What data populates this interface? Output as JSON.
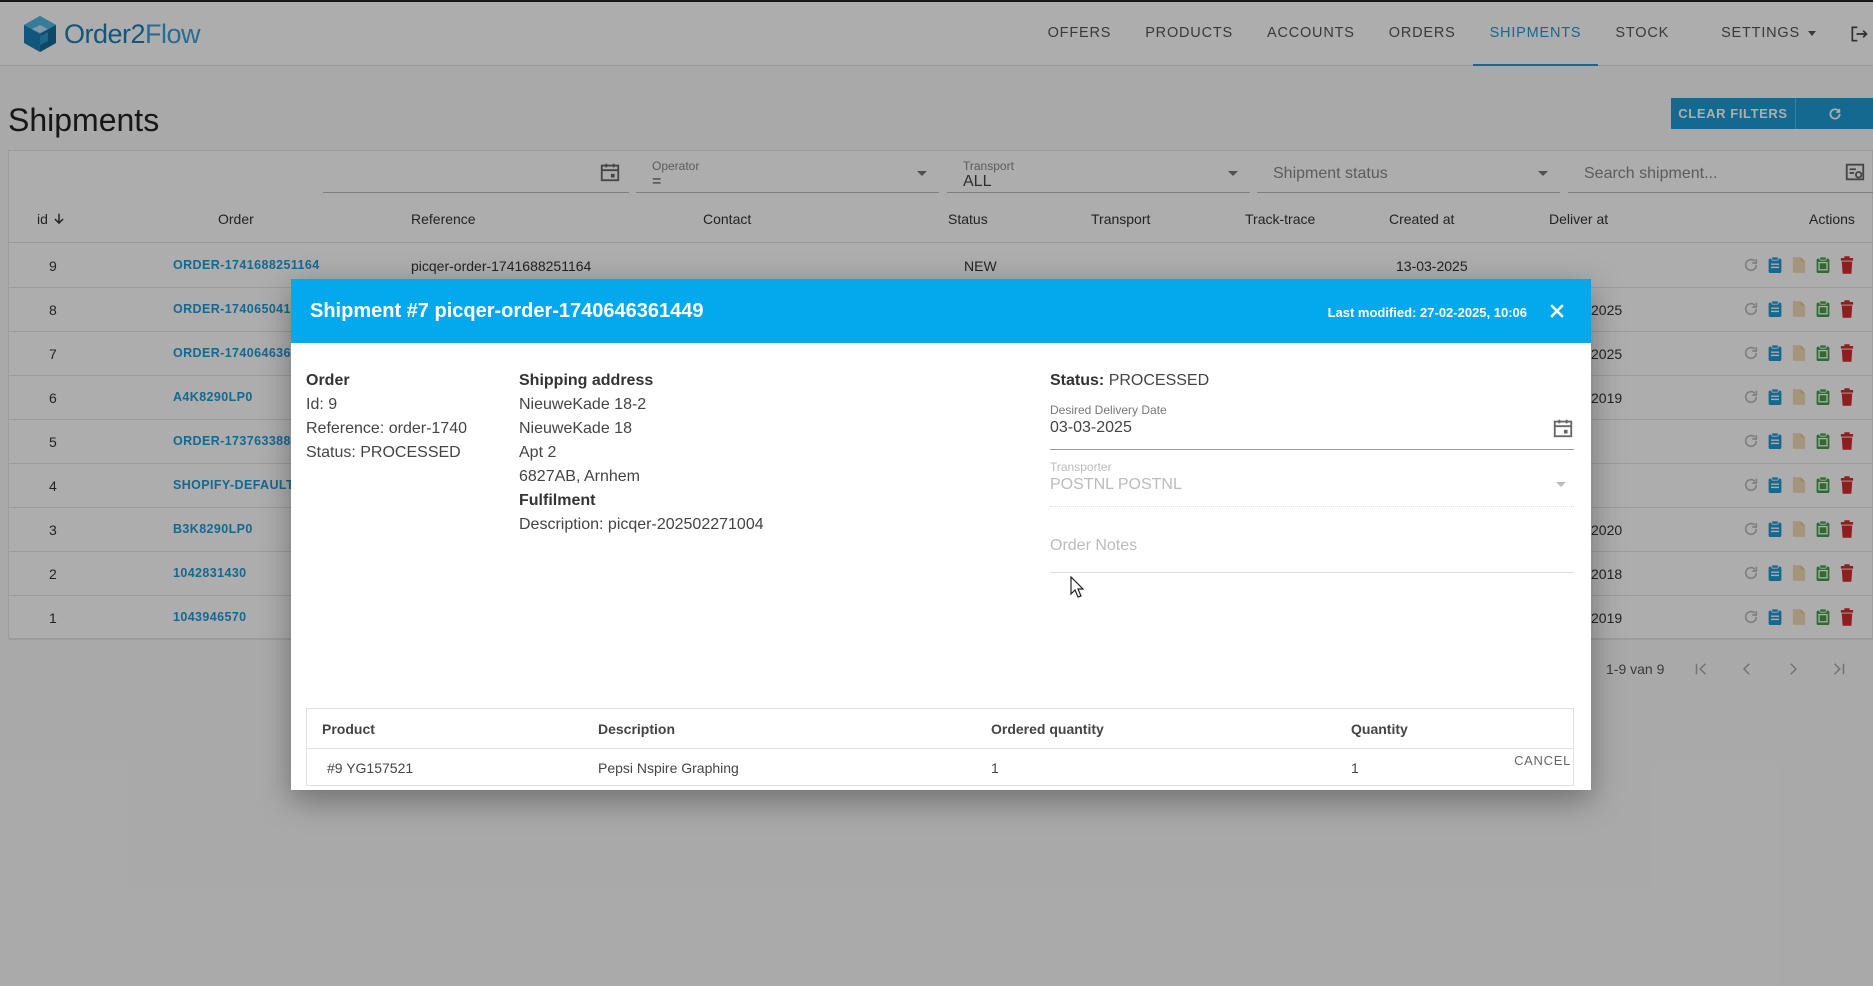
{
  "app": {
    "logo_prefix": "Order2",
    "logo_suffix": "Flow"
  },
  "nav": [
    {
      "label": "OFFERS",
      "active": false
    },
    {
      "label": "PRODUCTS",
      "active": false
    },
    {
      "label": "ACCOUNTS",
      "active": false
    },
    {
      "label": "ORDERS",
      "active": false
    },
    {
      "label": "SHIPMENTS",
      "active": true
    },
    {
      "label": "STOCK",
      "active": false
    }
  ],
  "settings_label": "SETTINGS",
  "page_title": "Shipments",
  "buttons": {
    "clear_filters": "CLEAR FILTERS"
  },
  "filters": {
    "operator_label": "Operator",
    "operator_value": "=",
    "transport_label": "Transport",
    "transport_value": "ALL",
    "status_placeholder": "Shipment status",
    "search_placeholder": "Search shipment..."
  },
  "table": {
    "headers": {
      "id": "id",
      "order": "Order",
      "reference": "Reference",
      "contact": "Contact",
      "status": "Status",
      "transport": "Transport",
      "tracktrace": "Track-trace",
      "created": "Created at",
      "deliver": "Deliver at",
      "actions": "Actions"
    },
    "rows": [
      {
        "id": "9",
        "order": "ORDER-1741688251164",
        "reference": "picqer-order-1741688251164",
        "status": "NEW",
        "created": "13-03-2025",
        "deliver": ""
      },
      {
        "id": "8",
        "order": "ORDER-174065041",
        "reference": "",
        "status": "",
        "created": "",
        "deliver": "2025"
      },
      {
        "id": "7",
        "order": "ORDER-174064636",
        "reference": "",
        "status": "",
        "created": "",
        "deliver": "2025"
      },
      {
        "id": "6",
        "order": "A4K8290LP0",
        "reference": "",
        "status": "",
        "created": "",
        "deliver": "2019"
      },
      {
        "id": "5",
        "order": "ORDER-173763388",
        "reference": "",
        "status": "",
        "created": "",
        "deliver": ""
      },
      {
        "id": "4",
        "order": "SHOPIFY-DEFAULT",
        "reference": "",
        "status": "",
        "created": "",
        "deliver": ""
      },
      {
        "id": "3",
        "order": "B3K8290LP0",
        "reference": "",
        "status": "",
        "created": "",
        "deliver": "2020"
      },
      {
        "id": "2",
        "order": "1042831430",
        "reference": "",
        "status": "",
        "created": "",
        "deliver": "2018"
      },
      {
        "id": "1",
        "order": "1043946570",
        "reference": "",
        "status": "",
        "created": "",
        "deliver": "2019"
      }
    ]
  },
  "pager": {
    "range": "1-9 van 9"
  },
  "modal": {
    "title": "Shipment #7 picqer-order-1740646361449",
    "last_modified": "Last modified: 27-02-2025, 10:06",
    "order": {
      "heading": "Order",
      "id": "Id: 9",
      "reference": "Reference: order-1740",
      "status": "Status: PROCESSED"
    },
    "shipping": {
      "heading": "Shipping address",
      "line1": "NieuweKade 18-2",
      "line2": "NieuweKade 18",
      "line3": "Apt 2",
      "line4": "6827AB, Arnhem"
    },
    "fulfilment": {
      "heading": "Fulfilment",
      "description": "Description: picqer-202502271004"
    },
    "status_label": "Status:",
    "status_value": "PROCESSED",
    "delivery_label": "Desired Delivery Date",
    "delivery_value": "03-03-2025",
    "transporter_label": "Transporter",
    "transporter_value": "POSTNL POSTNL",
    "notes_placeholder": "Order Notes",
    "products": {
      "headers": {
        "product": "Product",
        "description": "Description",
        "ordered": "Ordered quantity",
        "quantity": "Quantity"
      },
      "rows": [
        {
          "product": "#9 YG157521",
          "description": "Pepsi Nspire Graphing",
          "ordered": "1",
          "quantity": "1"
        }
      ]
    },
    "cancel_label": "CANCEL"
  },
  "colors": {
    "accent": "#1e9bd6",
    "modal_header": "#03a9ec",
    "delete": "#d32f2f",
    "copy": "#43a047"
  }
}
